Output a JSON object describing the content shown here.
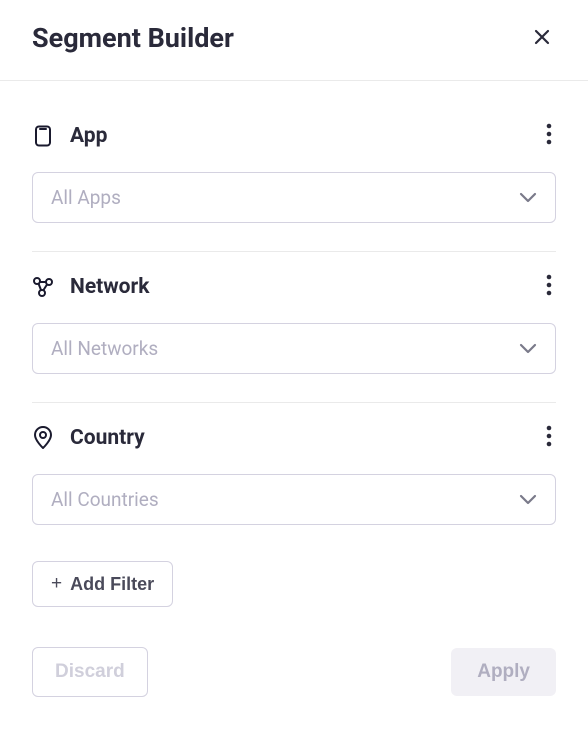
{
  "header": {
    "title": "Segment Builder"
  },
  "filters": {
    "app": {
      "label": "App",
      "placeholder": "All Apps"
    },
    "network": {
      "label": "Network",
      "placeholder": "All Networks"
    },
    "country": {
      "label": "Country",
      "placeholder": "All Countries"
    }
  },
  "actions": {
    "add_filter": "Add Filter",
    "discard": "Discard",
    "apply": "Apply"
  }
}
